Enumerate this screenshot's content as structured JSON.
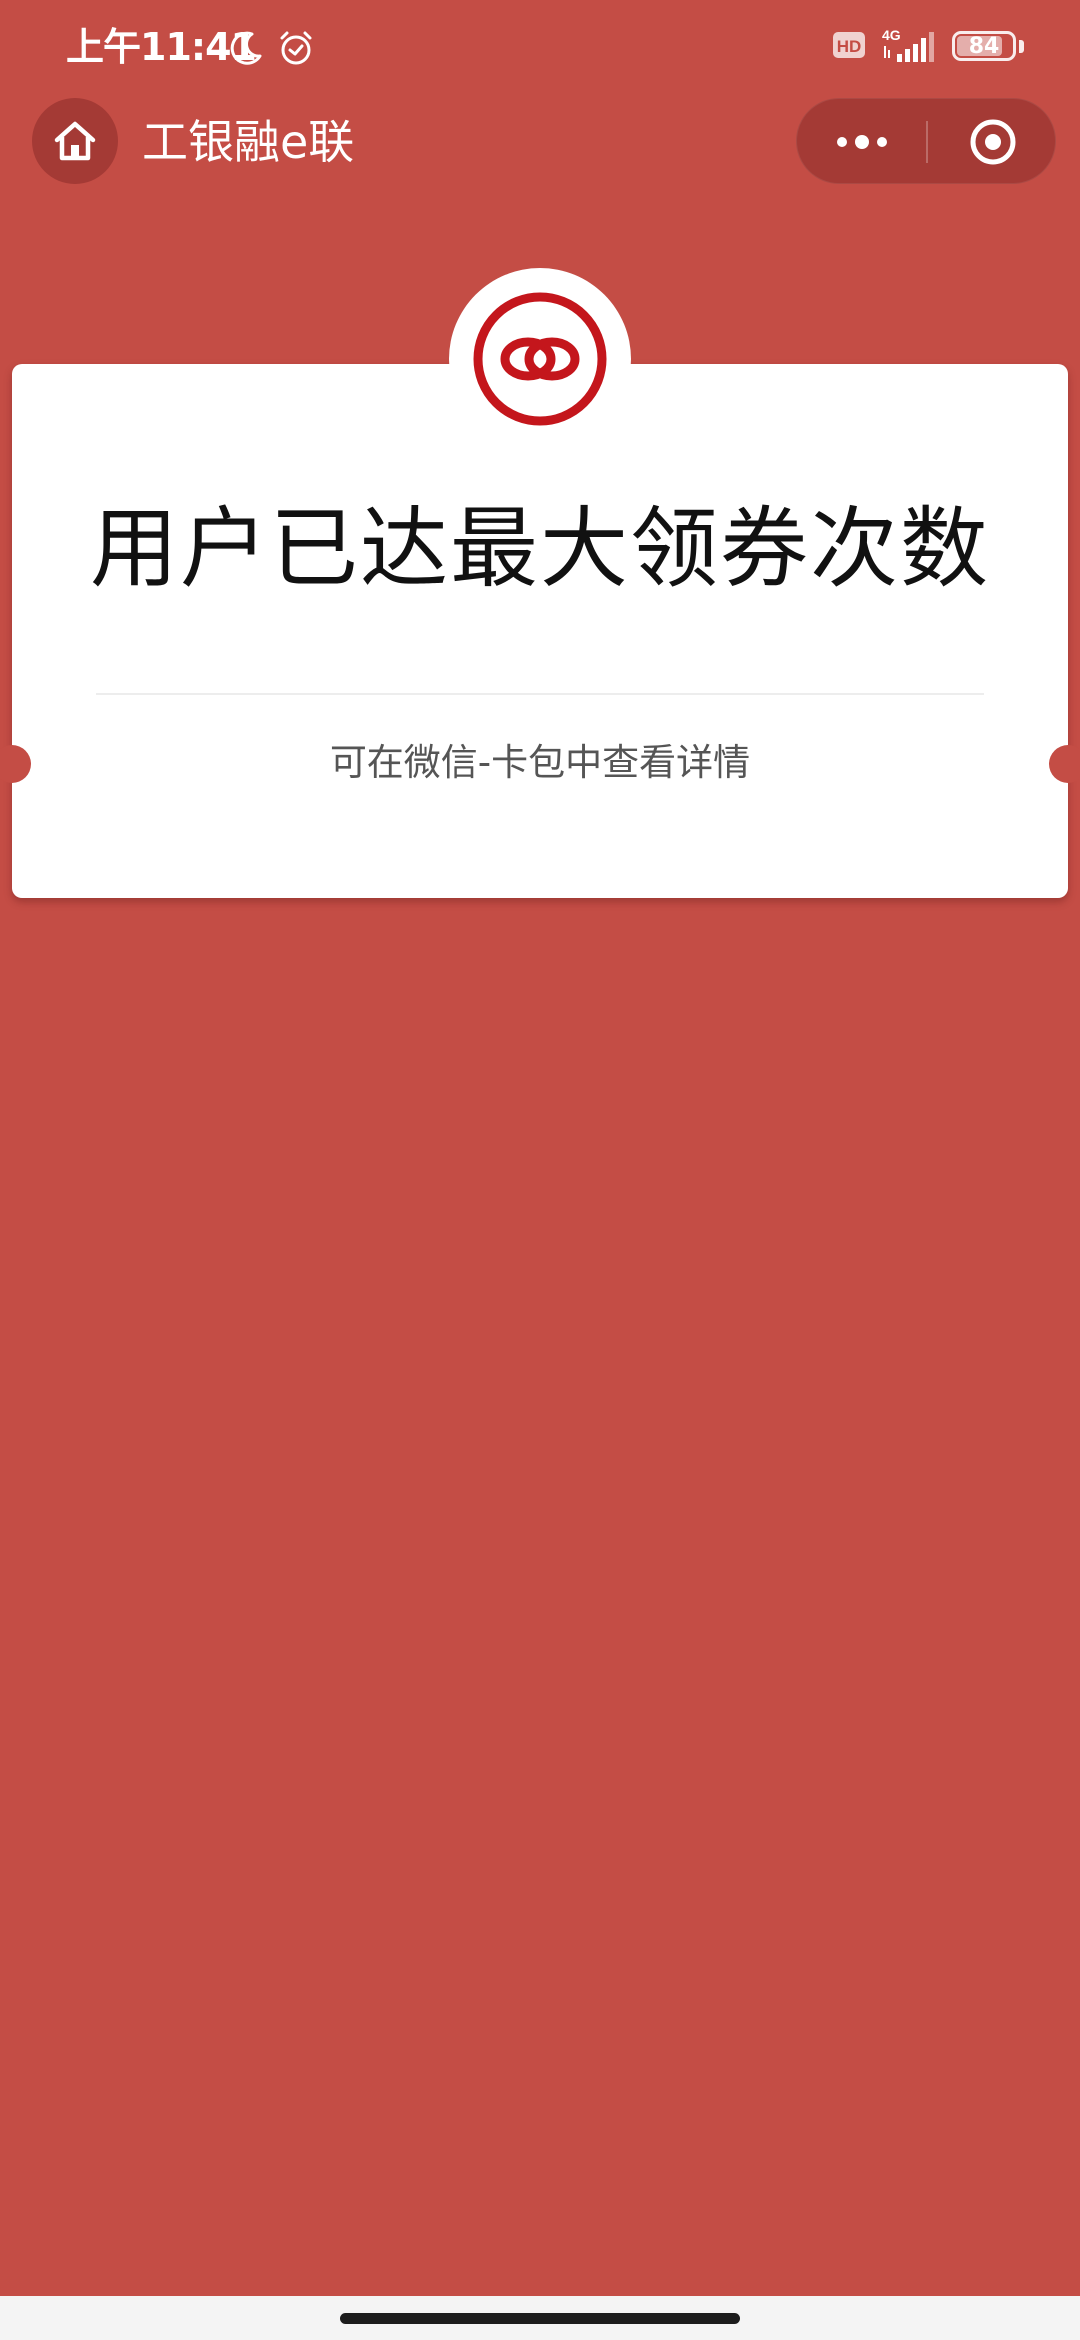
{
  "status_bar": {
    "time": "上午11:41",
    "network": "4G",
    "hd": "HD",
    "battery_level": "84",
    "battery_fraction": 0.84,
    "icons": [
      "moon-icon",
      "alarm-icon",
      "hd-icon",
      "signal-icon",
      "battery-icon"
    ]
  },
  "nav": {
    "title": "工银融e联",
    "home_icon": "home-icon",
    "more_icon": "more-dots-icon",
    "close_icon": "target-close-icon"
  },
  "card": {
    "logo_icon": "icbc-rings-logo-icon",
    "title": "用户已达最大领券次数",
    "subtitle": "可在微信-卡包中查看详情"
  },
  "colors": {
    "background": "#C44D45",
    "nav_button": "#A43A35",
    "logo_red": "#C4161C",
    "card": "#FFFFFF"
  }
}
